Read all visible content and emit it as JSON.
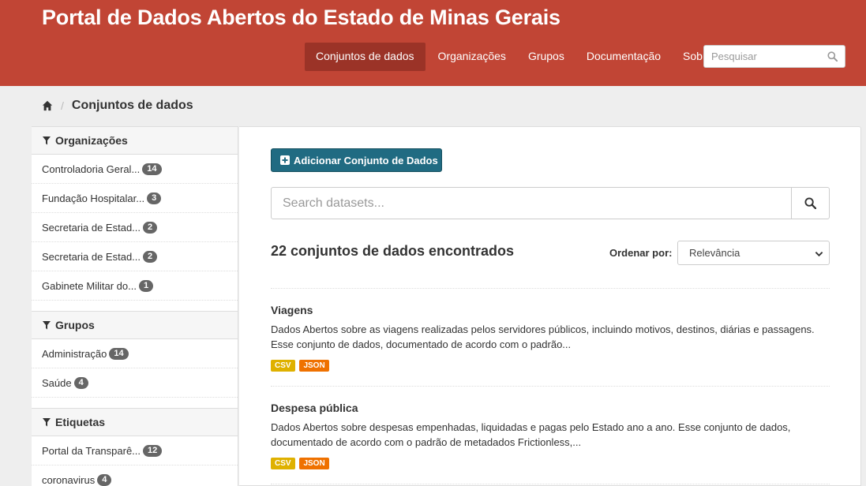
{
  "header": {
    "site_title": "Portal de Dados Abertos do Estado de Minas Gerais",
    "nav": [
      {
        "label": "Conjuntos de dados",
        "active": true
      },
      {
        "label": "Organizações"
      },
      {
        "label": "Grupos"
      },
      {
        "label": "Documentação"
      },
      {
        "label": "Sobre"
      }
    ],
    "search_placeholder": "Pesquisar",
    "brand_color": "#c14535"
  },
  "breadcrumb": {
    "home_icon": "home-icon",
    "current": "Conjuntos de dados"
  },
  "sidebar": {
    "organizations": {
      "title": "Organizações",
      "items": [
        {
          "label": "Controladoria Geral...",
          "count": "14"
        },
        {
          "label": "Fundação Hospitalar...",
          "count": "3"
        },
        {
          "label": "Secretaria de Estad...",
          "count": "2"
        },
        {
          "label": "Secretaria de Estad...",
          "count": "2"
        },
        {
          "label": "Gabinete Militar do...",
          "count": "1"
        }
      ]
    },
    "groups": {
      "title": "Grupos",
      "items": [
        {
          "label": "Administração",
          "count": "14"
        },
        {
          "label": "Saúde",
          "count": "4"
        }
      ]
    },
    "tags": {
      "title": "Etiquetas",
      "items": [
        {
          "label": "Portal da Transparê...",
          "count": "12"
        },
        {
          "label": "coronavirus",
          "count": "4"
        }
      ]
    }
  },
  "main": {
    "add_button": "Adicionar Conjunto de Dados",
    "search_placeholder": "Search datasets...",
    "results_count": "22 conjuntos de dados encontrados",
    "order_label": "Ordenar por:",
    "order_selected": "Relevância",
    "datasets": [
      {
        "title": "Viagens",
        "description": "Dados Abertos sobre as viagens realizadas pelos servidores públicos, incluindo motivos, destinos, diárias e passagens. Esse conjunto de dados, documentado de acordo com o padrão...",
        "formats": [
          "CSV",
          "JSON"
        ]
      },
      {
        "title": "Despesa pública",
        "description": "Dados Abertos sobre despesas empenhadas, liquidadas e pagas pelo Estado ano a ano. Esse conjunto de dados, documentado de acordo com o padrão de metadados Frictionless,...",
        "formats": [
          "CSV",
          "JSON"
        ]
      }
    ],
    "format_colors": {
      "CSV": "#dfb100",
      "JSON": "#ef7100"
    }
  }
}
